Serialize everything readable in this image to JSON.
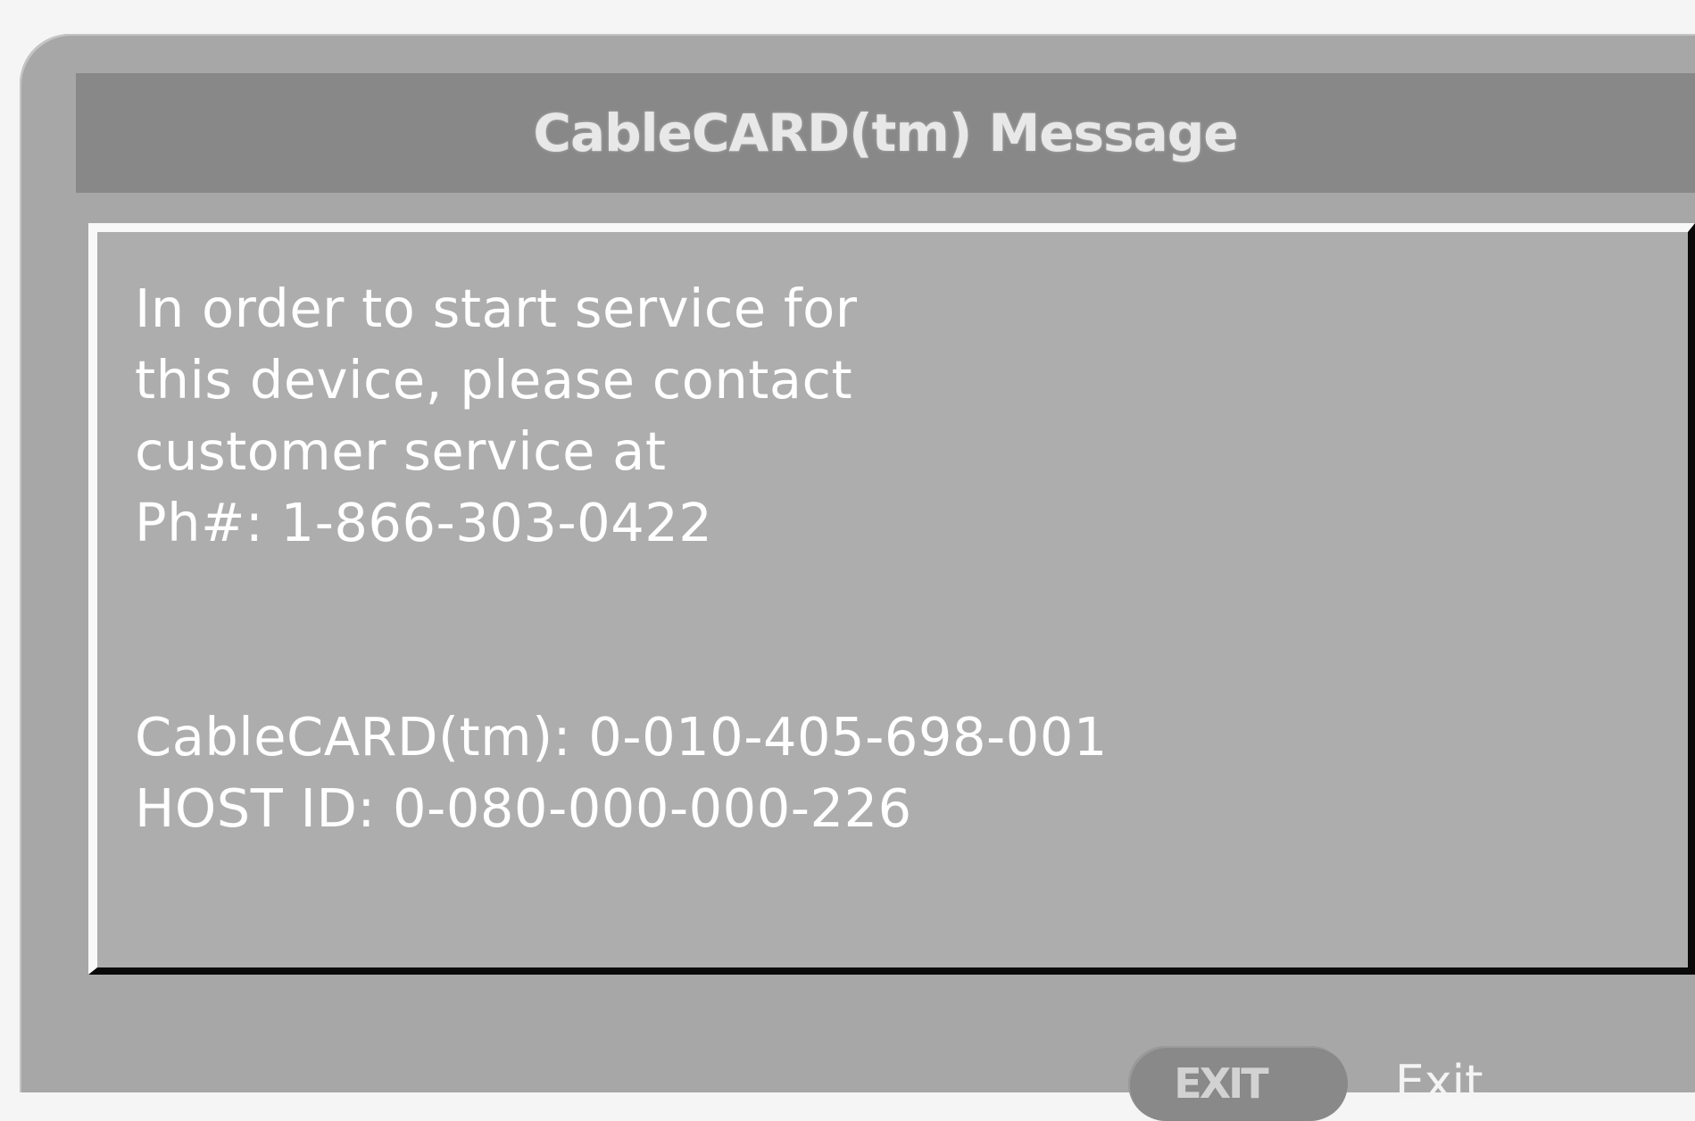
{
  "dialog": {
    "title": "CableCARD(tm) Message",
    "message_lines": [
      "In order to start service for",
      "this device, please contact",
      "customer service at",
      "Ph#: 1-866-303-0422",
      "",
      "",
      "CableCARD(tm): 0-010-405-698-001",
      "HOST ID: 0-080-000-000-226"
    ]
  },
  "footer": {
    "exit_button_label": "EXIT",
    "exit_label": "Exit"
  },
  "colors": {
    "page_background": "#f5f5f5",
    "dialog_background": "#a7a7a7",
    "title_bar": "#888888",
    "message_box": "#adadad",
    "text": "#ffffff",
    "exit_button": "#898989"
  }
}
